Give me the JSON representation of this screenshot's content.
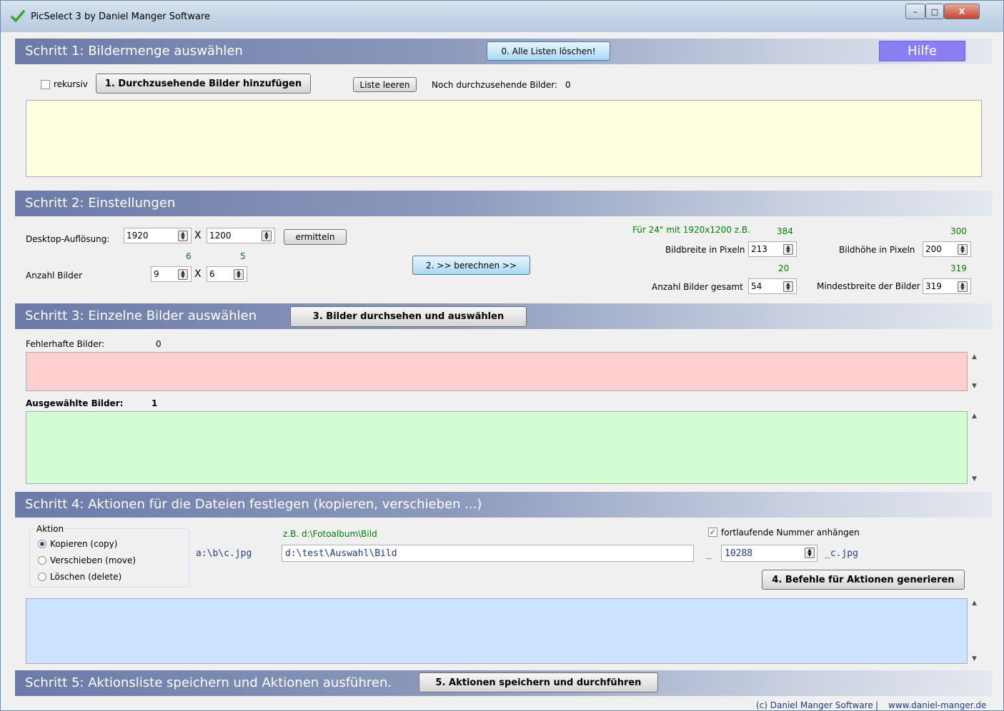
{
  "window": {
    "title": "PicSelect 3 by Daniel Manger Software",
    "minimize": "‒",
    "maximize": "□",
    "close": "X"
  },
  "step1": {
    "header": "Schritt 1: Bildermenge auswählen",
    "clear_all": "0. Alle Listen löschen!",
    "help": "Hilfe",
    "recursive_label": "rekursiv",
    "add_images": "1. Durchzusehende Bilder hinzufügen",
    "clear_list": "Liste leeren",
    "remaining_label": "Noch durchzusehende Bilder:",
    "remaining_count": "0",
    "list_color": "#ffffe1"
  },
  "step2": {
    "header": "Schritt 2: Einstellungen",
    "desktop_label": "Desktop-Auflösung:",
    "desktop_width": "1920",
    "desktop_height": "1200",
    "times1": "X",
    "determine": "ermitteln",
    "hint_cols": "6",
    "hint_rows": "5",
    "count_label": "Anzahl Bilder",
    "cols": "9",
    "times2": "X",
    "rows": "6",
    "calculate": "2. >> berechnen >>",
    "example_hint": "Für 24\" mit 1920x1200 z.B.",
    "hint_width": "384",
    "hint_height": "300",
    "width_label": "Bildbreite in Pixeln",
    "width_value": "213",
    "height_label": "Bildhöhe in Pixeln",
    "height_value": "200",
    "hint_total": "20",
    "hint_min": "319",
    "total_label": "Anzahl Bilder gesamt",
    "total_value": "54",
    "min_label": "Mindestbreite der Bilder",
    "min_value": "319"
  },
  "step3": {
    "header": "Schritt 3: Einzelne Bilder auswählen",
    "browse": "3. Bilder durchsehen und auswählen",
    "faulty_label": "Fehlerhafte Bilder:",
    "faulty_count": "0",
    "selected_label": "Ausgewählte Bilder:",
    "selected_count": "1",
    "faulty_color": "#ffcfcf",
    "selected_color": "#d2fdd2"
  },
  "step4": {
    "header": "Schritt 4: Aktionen für die Dateien festlegen (kopieren, verschieben ...)",
    "action_group": "Aktion",
    "opt_copy": "Kopieren (copy)",
    "opt_move": "Verschieben (move)",
    "opt_delete": "Löschen (delete)",
    "selected_option": "copy",
    "source_example": "a:\\b\\c.jpg",
    "target_hint": "z.B. d:\\Fotoalbum\\Bild",
    "target_path": "d:\\test\\Auswahl\\Bild",
    "sequence_label": "fortlaufende Nummer anhängen",
    "sequence_checked": true,
    "separator": "_",
    "sequence_value": "10288",
    "suffix": "_c.jpg",
    "generate": "4. Befehle für Aktionen generieren",
    "list_color": "#cce4ff"
  },
  "step5": {
    "header": "Schritt 5: Aktionsliste speichern und Aktionen ausführen.",
    "execute": "5. Aktionen speichern und durchführen"
  },
  "footer": {
    "copyright": "(c) Daniel Manger Software",
    "divider": "|",
    "website": "www.daniel-manger.de"
  }
}
